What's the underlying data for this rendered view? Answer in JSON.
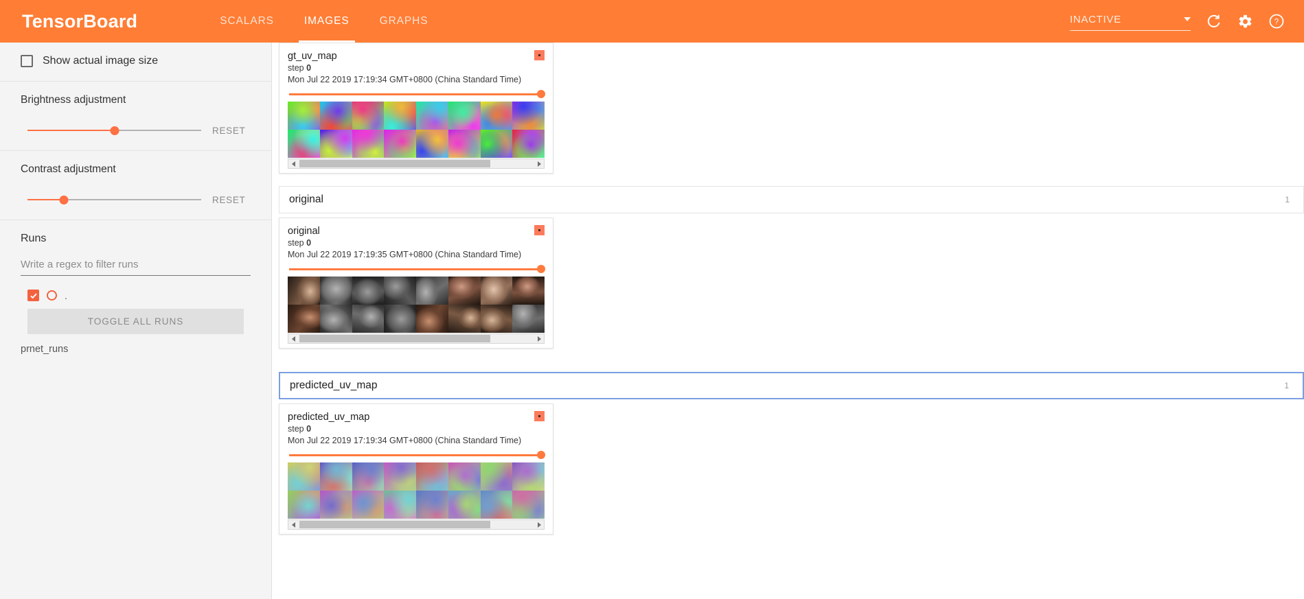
{
  "header": {
    "brand": "TensorBoard",
    "tabs": [
      {
        "label": "SCALARS",
        "active": false
      },
      {
        "label": "IMAGES",
        "active": true
      },
      {
        "label": "GRAPHS",
        "active": false
      }
    ],
    "status": "INACTIVE",
    "icons": [
      "refresh-icon",
      "gear-icon",
      "help-icon"
    ],
    "accent_color": "#ff7d34"
  },
  "sidebar": {
    "show_actual_size": {
      "label": "Show actual image size",
      "checked": false
    },
    "brightness": {
      "label": "Brightness adjustment",
      "reset_label": "RESET",
      "value_pct": 50
    },
    "contrast": {
      "label": "Contrast adjustment",
      "reset_label": "RESET",
      "value_pct": 21
    },
    "runs": {
      "title": "Runs",
      "filter_placeholder": "Write a regex to filter runs",
      "filter_value": "",
      "selector_label": ".",
      "toggle_all_label": "TOGGLE ALL RUNS",
      "run_names": [
        "prnet_runs"
      ]
    }
  },
  "main": {
    "cards": [
      {
        "tag": "gt_uv_map",
        "step_label": "step",
        "step_value": "0",
        "timestamp": "Mon Jul 22 2019 17:19:34 GMT+0800 (China Standard Time)",
        "kind": "uvmap"
      },
      {
        "tag": "original",
        "step_label": "step",
        "step_value": "0",
        "timestamp": "Mon Jul 22 2019 17:19:35 GMT+0800 (China Standard Time)",
        "kind": "faces"
      },
      {
        "tag": "predicted_uv_map",
        "step_label": "step",
        "step_value": "0",
        "timestamp": "Mon Jul 22 2019 17:19:34 GMT+0800 (China Standard Time)",
        "kind": "uvmap2"
      }
    ],
    "sections": [
      {
        "title": "original",
        "count": "1",
        "focused": false
      },
      {
        "title": "predicted_uv_map",
        "count": "1",
        "focused": true
      }
    ]
  }
}
